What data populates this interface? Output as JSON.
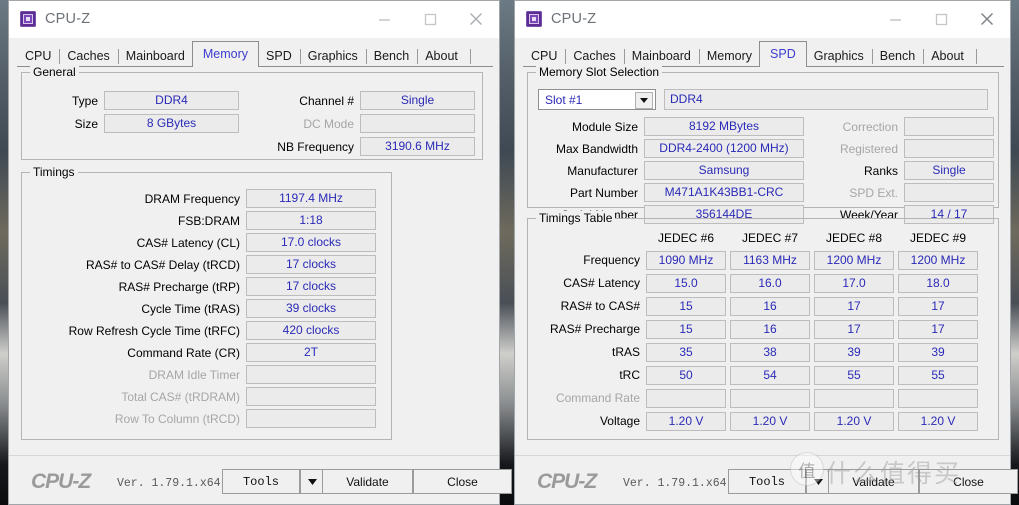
{
  "window_controls": {
    "minimize": "minimize-icon",
    "maximize": "maximize-icon",
    "close": "close-icon"
  },
  "left_window": {
    "title": "CPU-Z",
    "tabs": [
      {
        "label": "CPU",
        "active": false
      },
      {
        "label": "Caches",
        "active": false
      },
      {
        "label": "Mainboard",
        "active": false
      },
      {
        "label": "Memory",
        "active": true
      },
      {
        "label": "SPD",
        "active": false
      },
      {
        "label": "Graphics",
        "active": false
      },
      {
        "label": "Bench",
        "active": false
      },
      {
        "label": "About",
        "active": false
      }
    ],
    "general": {
      "legend": "General",
      "type_label": "Type",
      "type_value": "DDR4",
      "size_label": "Size",
      "size_value": "8 GBytes",
      "channel_label": "Channel #",
      "channel_value": "Single",
      "dcmode_label": "DC Mode",
      "dcmode_value": "",
      "nbfreq_label": "NB Frequency",
      "nbfreq_value": "3190.6 MHz"
    },
    "timings": {
      "legend": "Timings",
      "rows": [
        {
          "label": "DRAM Frequency",
          "value": "1197.4 MHz",
          "disabled": false
        },
        {
          "label": "FSB:DRAM",
          "value": "1:18",
          "disabled": false
        },
        {
          "label": "CAS# Latency (CL)",
          "value": "17.0 clocks",
          "disabled": false
        },
        {
          "label": "RAS# to CAS# Delay (tRCD)",
          "value": "17 clocks",
          "disabled": false
        },
        {
          "label": "RAS# Precharge (tRP)",
          "value": "17 clocks",
          "disabled": false
        },
        {
          "label": "Cycle Time (tRAS)",
          "value": "39 clocks",
          "disabled": false
        },
        {
          "label": "Row Refresh Cycle Time (tRFC)",
          "value": "420 clocks",
          "disabled": false
        },
        {
          "label": "Command Rate (CR)",
          "value": "2T",
          "disabled": false
        },
        {
          "label": "DRAM Idle Timer",
          "value": "",
          "disabled": true
        },
        {
          "label": "Total CAS# (tRDRAM)",
          "value": "",
          "disabled": true
        },
        {
          "label": "Row To Column (tRCD)",
          "value": "",
          "disabled": true
        }
      ]
    },
    "statusbar": {
      "logo": "CPU-Z",
      "version": "Ver. 1.79.1.x64",
      "tools_label": "Tools",
      "dropdown_icon": "chevron-down-icon",
      "validate_label": "Validate",
      "close_label": "Close"
    }
  },
  "right_window": {
    "title": "CPU-Z",
    "tabs": [
      {
        "label": "CPU",
        "active": false
      },
      {
        "label": "Caches",
        "active": false
      },
      {
        "label": "Mainboard",
        "active": false
      },
      {
        "label": "Memory",
        "active": false
      },
      {
        "label": "SPD",
        "active": true
      },
      {
        "label": "Graphics",
        "active": false
      },
      {
        "label": "Bench",
        "active": false
      },
      {
        "label": "About",
        "active": false
      }
    ],
    "slot_selection": {
      "legend": "Memory Slot Selection",
      "slot_value": "Slot #1",
      "dropdown_icon": "chevron-down-icon",
      "module_type": "DDR4",
      "left_rows": [
        {
          "label": "Module Size",
          "value": "8192 MBytes",
          "disabled": false
        },
        {
          "label": "Max Bandwidth",
          "value": "DDR4-2400 (1200 MHz)",
          "disabled": false
        },
        {
          "label": "Manufacturer",
          "value": "Samsung",
          "disabled": false
        },
        {
          "label": "Part Number",
          "value": "M471A1K43BB1-CRC",
          "disabled": false
        },
        {
          "label": "Serial Number",
          "value": "356144DE",
          "disabled": false
        }
      ],
      "right_rows": [
        {
          "label": "Correction",
          "value": "",
          "disabled": true
        },
        {
          "label": "Registered",
          "value": "",
          "disabled": true
        },
        {
          "label": "Ranks",
          "value": "Single",
          "disabled": false
        },
        {
          "label": "SPD Ext.",
          "value": "",
          "disabled": true
        },
        {
          "label": "Week/Year",
          "value": "14 / 17",
          "disabled": false
        }
      ]
    },
    "timings_table": {
      "legend": "Timings Table",
      "columns": [
        "JEDEC #6",
        "JEDEC #7",
        "JEDEC #8",
        "JEDEC #9"
      ],
      "rows": [
        {
          "label": "Frequency",
          "disabled": false,
          "values": [
            "1090 MHz",
            "1163 MHz",
            "1200 MHz",
            "1200 MHz"
          ]
        },
        {
          "label": "CAS# Latency",
          "disabled": false,
          "values": [
            "15.0",
            "16.0",
            "17.0",
            "18.0"
          ]
        },
        {
          "label": "RAS# to CAS#",
          "disabled": false,
          "values": [
            "15",
            "16",
            "17",
            "17"
          ]
        },
        {
          "label": "RAS# Precharge",
          "disabled": false,
          "values": [
            "15",
            "16",
            "17",
            "17"
          ]
        },
        {
          "label": "tRAS",
          "disabled": false,
          "values": [
            "35",
            "38",
            "39",
            "39"
          ]
        },
        {
          "label": "tRC",
          "disabled": false,
          "values": [
            "50",
            "54",
            "55",
            "55"
          ]
        },
        {
          "label": "Command Rate",
          "disabled": true,
          "values": [
            "",
            "",
            "",
            ""
          ]
        },
        {
          "label": "Voltage",
          "disabled": false,
          "values": [
            "1.20 V",
            "1.20 V",
            "1.20 V",
            "1.20 V"
          ]
        }
      ]
    },
    "statusbar": {
      "logo": "CPU-Z",
      "version": "Ver. 1.79.1.x64",
      "tools_label": "Tools",
      "dropdown_icon": "chevron-down-icon",
      "validate_label": "Validate",
      "close_label": "Close"
    },
    "watermark": {
      "badge": "值",
      "text": "什么值得买"
    }
  },
  "colors": {
    "value_blue": "#2a2ab8",
    "active_tab": "#3c3cd0",
    "field_bg": "#ebebeb",
    "window_bg": "#f0f0f0",
    "disabled_text": "#a6a6a6"
  }
}
